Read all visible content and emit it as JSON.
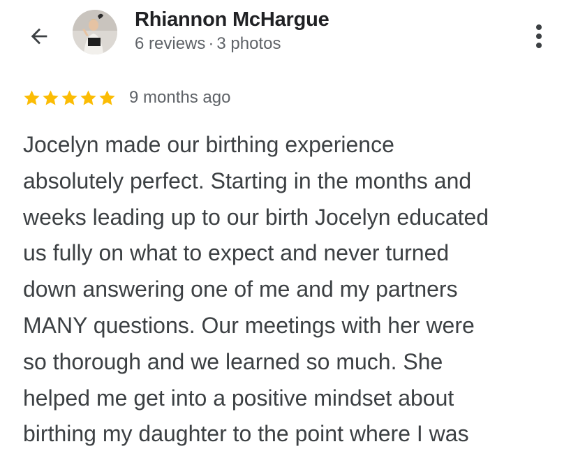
{
  "header": {
    "back_icon": "arrow-left-icon",
    "avatar_icon": "reviewer-avatar",
    "reviewer_name": "Rhiannon McHargue",
    "reviews_count": "6 reviews",
    "separator": "·",
    "photos_count": "3 photos",
    "more_icon": "more-vertical-icon"
  },
  "review": {
    "rating": 5,
    "rating_max": 5,
    "star_color": "#fbbc04",
    "time_ago": "9 months ago",
    "lines": [
      "Jocelyn made our birthing experience",
      "absolutely perfect. Starting in the months and",
      "weeks leading up to our birth Jocelyn educated",
      "us fully on what to expect and never turned",
      "down answering one of me and my partners",
      "MANY questions. Our meetings with her were",
      "so thorough and we learned so much. She",
      "helped me get into a positive mindset about",
      "birthing my daughter to the point where I was"
    ]
  }
}
